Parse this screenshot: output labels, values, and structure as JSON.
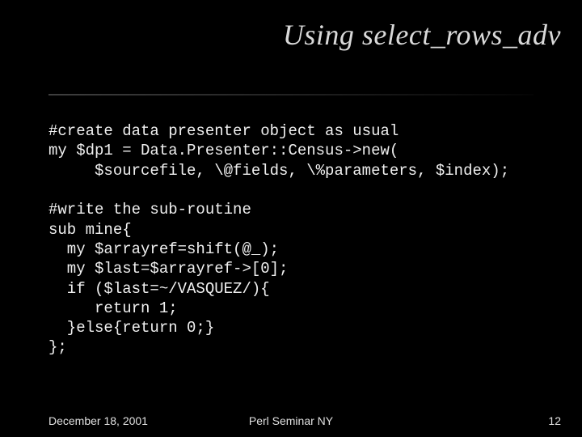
{
  "title": "Using select_rows_adv",
  "code": {
    "l1": "#create data presenter object as usual",
    "l2": "my $dp1 = Data.Presenter::Census->new(",
    "l3": "     $sourcefile, \\@fields, \\%parameters, $index);",
    "l4": "",
    "l5": "#write the sub-routine",
    "l6": "sub mine{",
    "l7": "  my $arrayref=shift(@_);",
    "l8": "  my $last=$arrayref->[0];",
    "l9": "  if ($last=~/VASQUEZ/){",
    "l10": "     return 1;",
    "l11": "  }else{return 0;}",
    "l12": "};"
  },
  "footer": {
    "date": "December 18, 2001",
    "center": "Perl Seminar NY",
    "page": "12"
  }
}
